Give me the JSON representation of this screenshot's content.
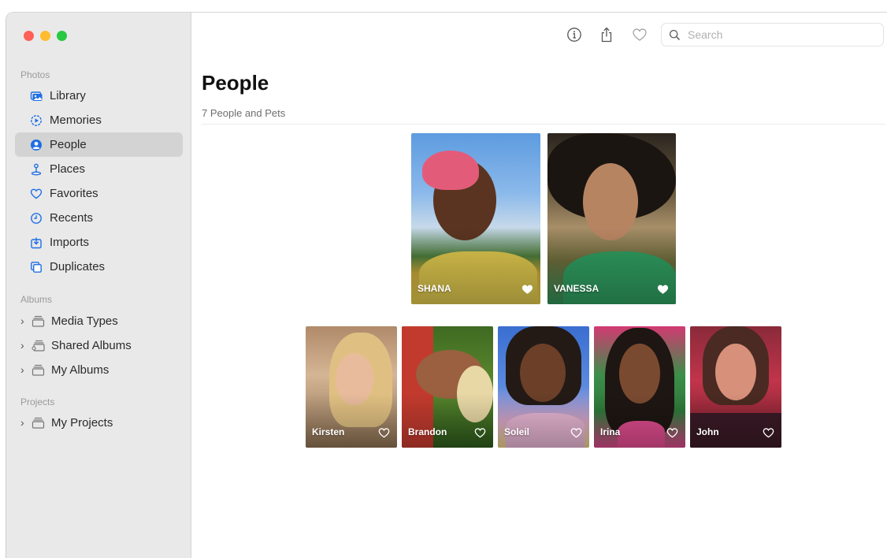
{
  "sidebar": {
    "sections": {
      "photos": "Photos",
      "albums": "Albums",
      "projects": "Projects"
    },
    "items": [
      {
        "label": "Library",
        "icon": "library-icon"
      },
      {
        "label": "Memories",
        "icon": "memories-icon"
      },
      {
        "label": "People",
        "icon": "people-icon",
        "selected": true
      },
      {
        "label": "Places",
        "icon": "places-icon"
      },
      {
        "label": "Favorites",
        "icon": "heart-icon"
      },
      {
        "label": "Recents",
        "icon": "clock-icon"
      },
      {
        "label": "Imports",
        "icon": "imports-icon"
      },
      {
        "label": "Duplicates",
        "icon": "duplicates-icon"
      }
    ],
    "albums": [
      {
        "label": "Media Types",
        "icon": "album-folder-icon"
      },
      {
        "label": "Shared Albums",
        "icon": "shared-album-icon"
      },
      {
        "label": "My Albums",
        "icon": "album-folder-icon"
      }
    ],
    "projects": [
      {
        "label": "My Projects",
        "icon": "album-folder-icon"
      }
    ]
  },
  "toolbar": {
    "info_icon": "info-icon",
    "share_icon": "share-icon",
    "favorite_icon": "heart-outline-icon",
    "search_placeholder": "Search"
  },
  "main": {
    "title": "People",
    "subtitle": "7 People and Pets",
    "featured": [
      {
        "name": "SHANA",
        "favorite": true
      },
      {
        "name": "VANESSA",
        "favorite": true
      }
    ],
    "people": [
      {
        "name": "Kirsten",
        "favorite": false
      },
      {
        "name": "Brandon",
        "favorite": false
      },
      {
        "name": "Soleil",
        "favorite": false
      },
      {
        "name": "Irina",
        "favorite": false
      },
      {
        "name": "John",
        "favorite": false
      }
    ]
  },
  "colors": {
    "accent": "#1f6fe5",
    "sidebar_bg": "#e9e9e9",
    "selected_bg": "#d3d3d3"
  }
}
